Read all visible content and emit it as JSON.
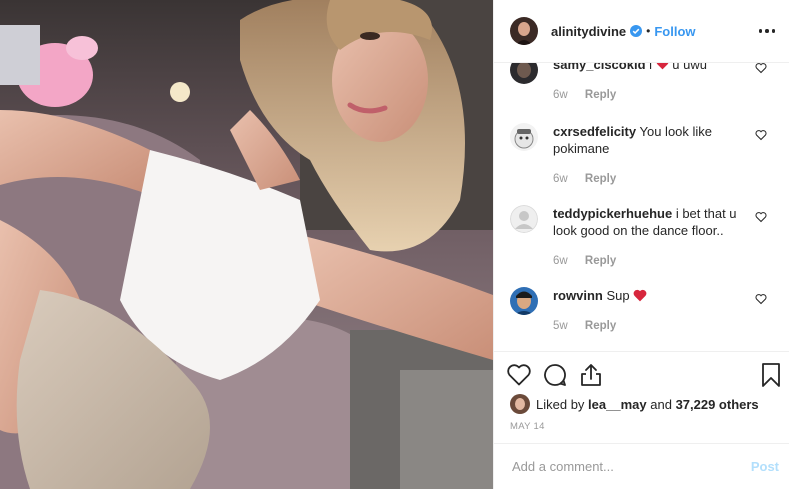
{
  "header": {
    "username": "alinitydivine",
    "separator": "•",
    "follow_label": "Follow"
  },
  "comments": [
    {
      "username": "samy_ciscokid",
      "text": "i",
      "text_after": "u uwu",
      "has_heart": true,
      "time": "6w",
      "reply": "Reply"
    },
    {
      "username": "cxrsedfelicity",
      "text": "You look like pokimane",
      "text_after": "",
      "has_heart": false,
      "time": "6w",
      "reply": "Reply"
    },
    {
      "username": "teddypickerhuehue",
      "text": "i bet that u look good on the dance floor..",
      "text_after": "",
      "has_heart": false,
      "time": "6w",
      "reply": "Reply"
    },
    {
      "username": "rowvinn",
      "text": "Sup",
      "text_after": "",
      "has_heart": true,
      "time": "5w",
      "reply": "Reply"
    }
  ],
  "likes": {
    "prefix": "Liked by",
    "user": "lea__may",
    "middle": "and",
    "count": "37,229 others"
  },
  "date": "MAY 14",
  "add_comment": {
    "placeholder": "Add a comment...",
    "post_label": "Post"
  },
  "colors": {
    "accent": "#3897f0",
    "heart": "#ed4956",
    "muted": "#999999"
  },
  "icons": [
    "verified-badge-icon",
    "more-options-icon",
    "like-icon",
    "comment-icon",
    "share-icon",
    "bookmark-icon"
  ]
}
